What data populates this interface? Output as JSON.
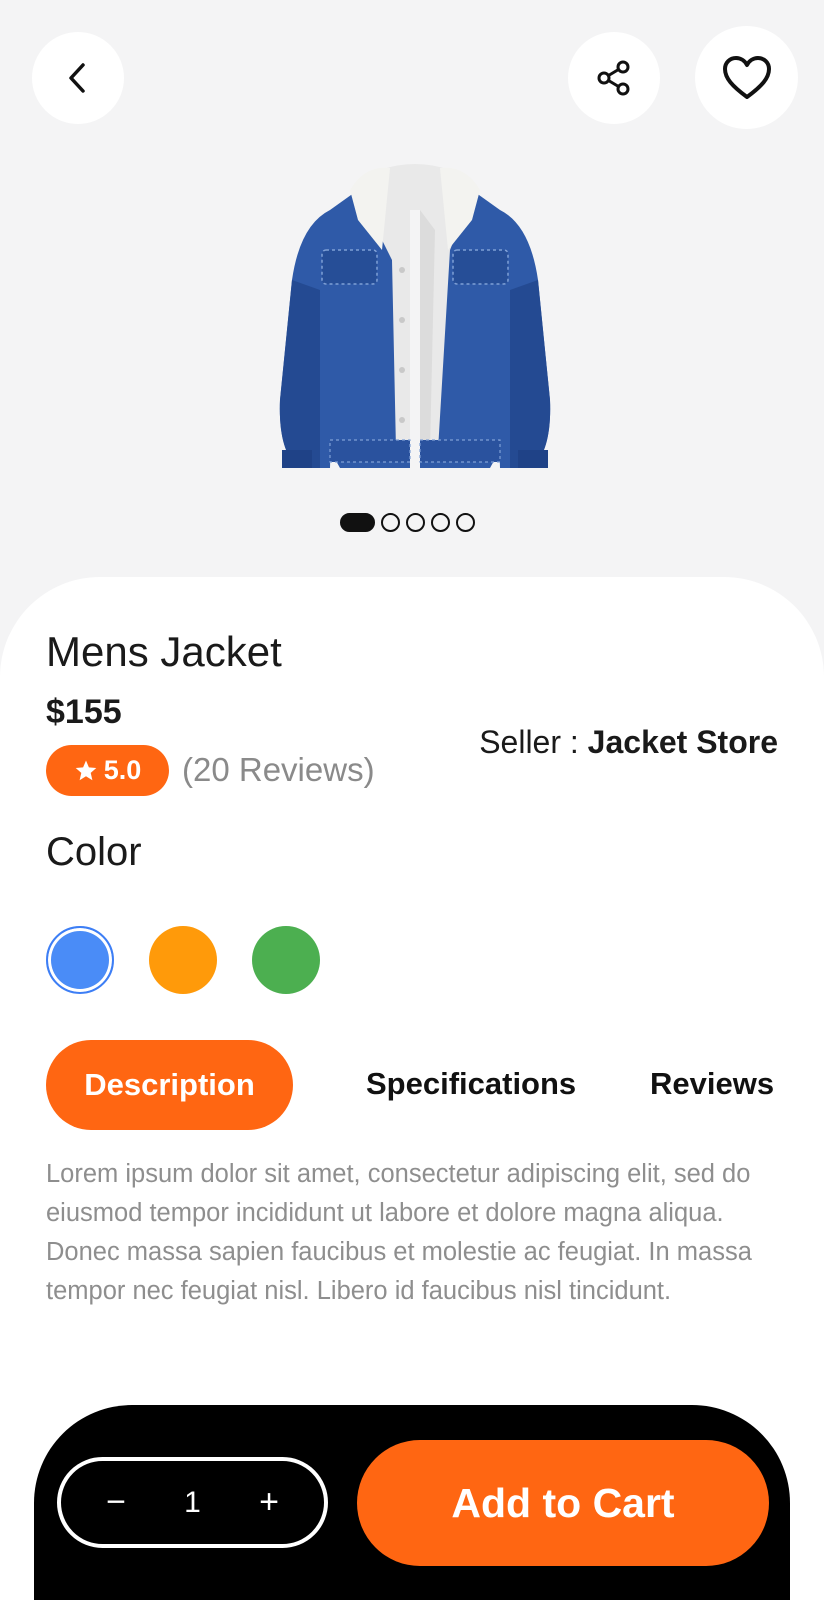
{
  "header": {
    "back_icon": "chevron-left-icon",
    "share_icon": "share-icon",
    "favorite_icon": "heart-icon"
  },
  "product": {
    "image": "denim-jacket-with-fleece-collar",
    "carousel": {
      "total": 5,
      "active_index": 0
    },
    "name": "Mens Jacket",
    "price": "$155",
    "rating": "5.0",
    "reviews": "(20 Reviews)",
    "seller_label": "Seller : ",
    "seller_name": "Jacket Store"
  },
  "color_section": {
    "heading": "Color",
    "swatches": [
      {
        "name": "blue",
        "hex": "#4a8cf7",
        "selected": true
      },
      {
        "name": "orange",
        "hex": "#ff9a0a",
        "selected": false
      },
      {
        "name": "green",
        "hex": "#4caf50",
        "selected": false
      }
    ]
  },
  "tabs": [
    {
      "label": "Description",
      "active": true
    },
    {
      "label": "Specifications",
      "active": false
    },
    {
      "label": "Reviews",
      "active": false
    }
  ],
  "description": "Lorem ipsum dolor sit amet, consectetur adipiscing elit, sed do eiusmod tempor incididunt ut labore et dolore magna aliqua. Donec massa sapien faucibus et molestie ac feugiat. In massa tempor nec feugiat nisl. Libero id faucibus nisl tincidunt.",
  "cart": {
    "minus": "−",
    "quantity": "1",
    "plus": "+",
    "add_label": "Add to Cart"
  },
  "colors": {
    "accent": "#ff6612",
    "background": "#f4f4f5",
    "cart_bar": "#000000"
  }
}
